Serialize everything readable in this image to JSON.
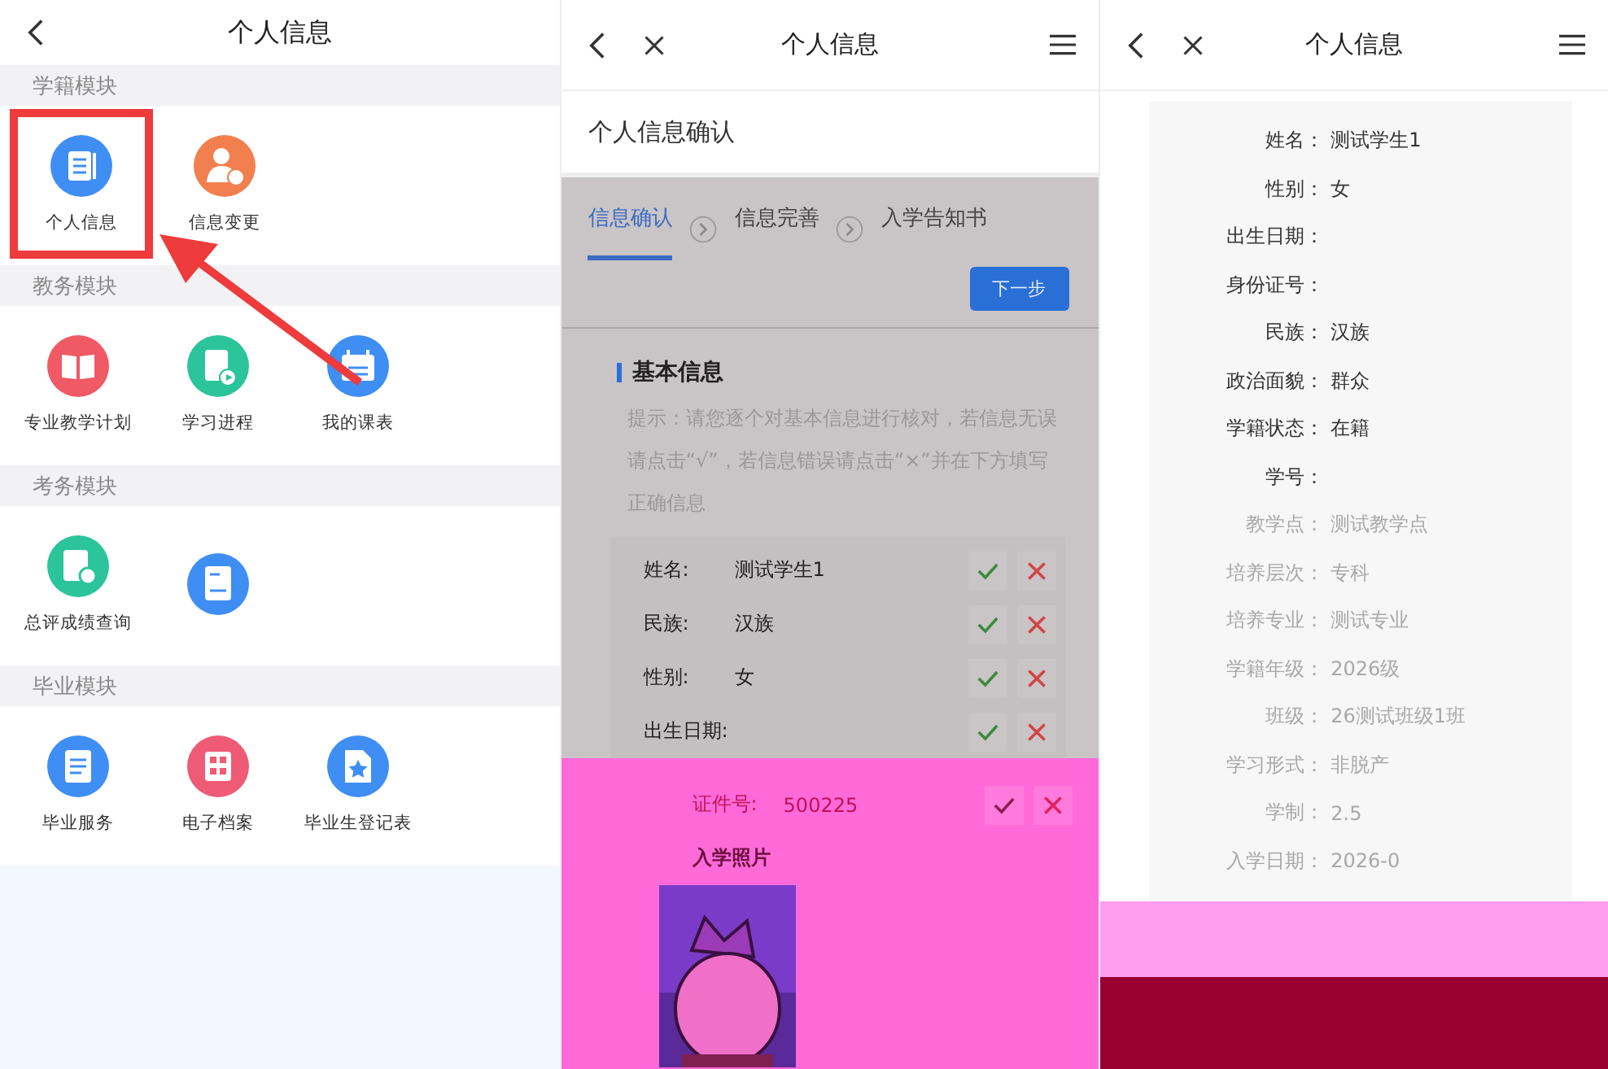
{
  "screens": [
    {
      "kind": "menu",
      "title": "个人信息",
      "sections": [
        {
          "title": "学籍模块",
          "items": [
            {
              "label": "个人信息",
              "kind": "document",
              "color": "#3f8ef3",
              "highlighted": true
            },
            {
              "label": "信息变更",
              "kind": "person",
              "color": "#f2804f",
              "highlighted": false
            }
          ]
        },
        {
          "title": "教务模块",
          "items": [
            {
              "label": "专业教学计划",
              "kind": "book",
              "color": "#ef5a64",
              "highlighted": false
            },
            {
              "label": "学习进程",
              "kind": "play-document",
              "color": "#2cc49b",
              "highlighted": false
            },
            {
              "label": "我的课表",
              "kind": "calendar",
              "color": "#3f8ef3",
              "highlighted": false
            }
          ]
        },
        {
          "title": "考务模块",
          "items": [
            {
              "label": "总评成绩查询",
              "kind": "search-document",
              "color": "#2cc49b",
              "highlighted": false
            },
            {
              "kind": "score-paper",
              "color": "#3f8ef3",
              "highlighted": false
            }
          ]
        },
        {
          "title": "毕业模块",
          "items": [
            {
              "label": "毕业服务",
              "kind": "list",
              "color": "#3f8ef3",
              "highlighted": false
            },
            {
              "label": "电子档案",
              "kind": "grid",
              "color": "#ef5a74",
              "highlighted": false
            },
            {
              "label": "毕业生登记表",
              "kind": "star-document",
              "color": "#3f8ef3",
              "highlighted": false
            }
          ]
        }
      ]
    },
    {
      "kind": "confirm",
      "title": "个人信息",
      "subtitle": "个人信息确认",
      "steps": [
        {
          "label": "信息确认",
          "selected": true
        },
        {
          "label": "信息完善",
          "selected": false
        },
        {
          "label": "入学告知书",
          "selected": false
        }
      ],
      "next_button": "下一步",
      "section_title": "基本信息",
      "hint": "提示：请您逐个对基本信息进行核对，若信息无误请点击“√”，若信息错误请点击“×”并在下方填写正确信息",
      "rows": [
        {
          "label": "姓名:",
          "value": "测试学生1"
        },
        {
          "label": "民族:",
          "value": "汉族"
        },
        {
          "label": "性别:",
          "value": "女"
        },
        {
          "label": "出生日期:"
        }
      ],
      "id_row": {
        "label": "证件号:",
        "value": "500225"
      },
      "photo_label": "入学照片"
    },
    {
      "kind": "details",
      "title": "个人信息",
      "fields": [
        {
          "label": "姓名：",
          "value": "测试学生1",
          "faded": false
        },
        {
          "label": "性别：",
          "value": "女",
          "faded": false
        },
        {
          "label": "出生日期：",
          "faded": false
        },
        {
          "label": "身份证号：",
          "faded": false
        },
        {
          "label": "民族：",
          "value": "汉族",
          "faded": false
        },
        {
          "label": "政治面貌：",
          "value": "群众",
          "faded": false
        },
        {
          "label": "学籍状态：",
          "value": "在籍",
          "faded": false
        },
        {
          "label": "学号：",
          "faded": false
        },
        {
          "label": "教学点：",
          "value": "测试教学点",
          "faded": true
        },
        {
          "label": "培养层次：",
          "value": "专科",
          "faded": true
        },
        {
          "label": "培养专业：",
          "value": "测试专业",
          "faded": true
        },
        {
          "label": "学籍年级：",
          "value": "2026级",
          "faded": true
        },
        {
          "label": "班级：",
          "value": "26测试班级1班",
          "faded": true
        },
        {
          "label": "学习形式：",
          "value": "非脱产",
          "faded": true
        },
        {
          "label": "学制：",
          "value": "2.5",
          "faded": true
        },
        {
          "label": "入学日期：",
          "value": "2026-0",
          "faded": true
        }
      ]
    }
  ]
}
